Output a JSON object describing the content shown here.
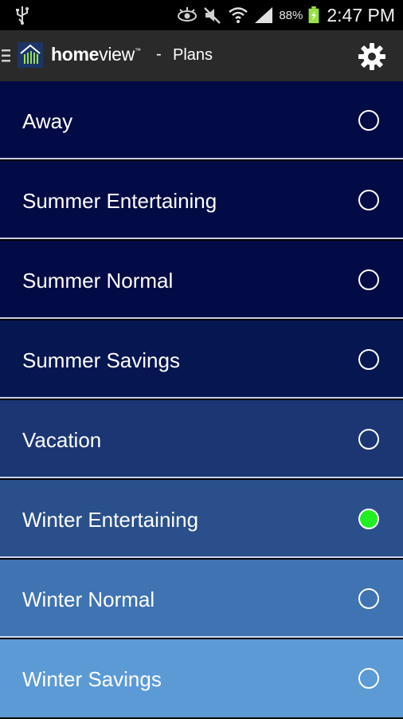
{
  "status_bar": {
    "battery_percent": "88%",
    "time": "2:47 PM",
    "icons": [
      "usb-icon",
      "eye-icon",
      "mute-icon",
      "wifi-icon",
      "signal-icon",
      "battery-icon"
    ]
  },
  "action_bar": {
    "brand_bold": "home",
    "brand_light": "view",
    "brand_tm": "™",
    "separator": "-",
    "title": "Plans",
    "icons": [
      "menu-icon",
      "app-logo-icon",
      "gear-icon"
    ]
  },
  "plans": [
    {
      "label": "Away",
      "selected": false
    },
    {
      "label": "Summer Entertaining",
      "selected": false
    },
    {
      "label": "Summer Normal",
      "selected": false
    },
    {
      "label": "Summer Savings",
      "selected": false
    },
    {
      "label": "Vacation",
      "selected": false
    },
    {
      "label": "Winter Entertaining",
      "selected": true
    },
    {
      "label": "Winter Normal",
      "selected": false
    },
    {
      "label": "Winter Savings",
      "selected": false
    }
  ],
  "colors": {
    "row_backgrounds": [
      "#020b45",
      "#020b45",
      "#020b45",
      "#061651",
      "#1b3672",
      "#2a4f8b",
      "#3f73b2",
      "#5c9ad6"
    ],
    "selected_radio": "#22ee22",
    "action_bar": "#2a2a2a"
  }
}
